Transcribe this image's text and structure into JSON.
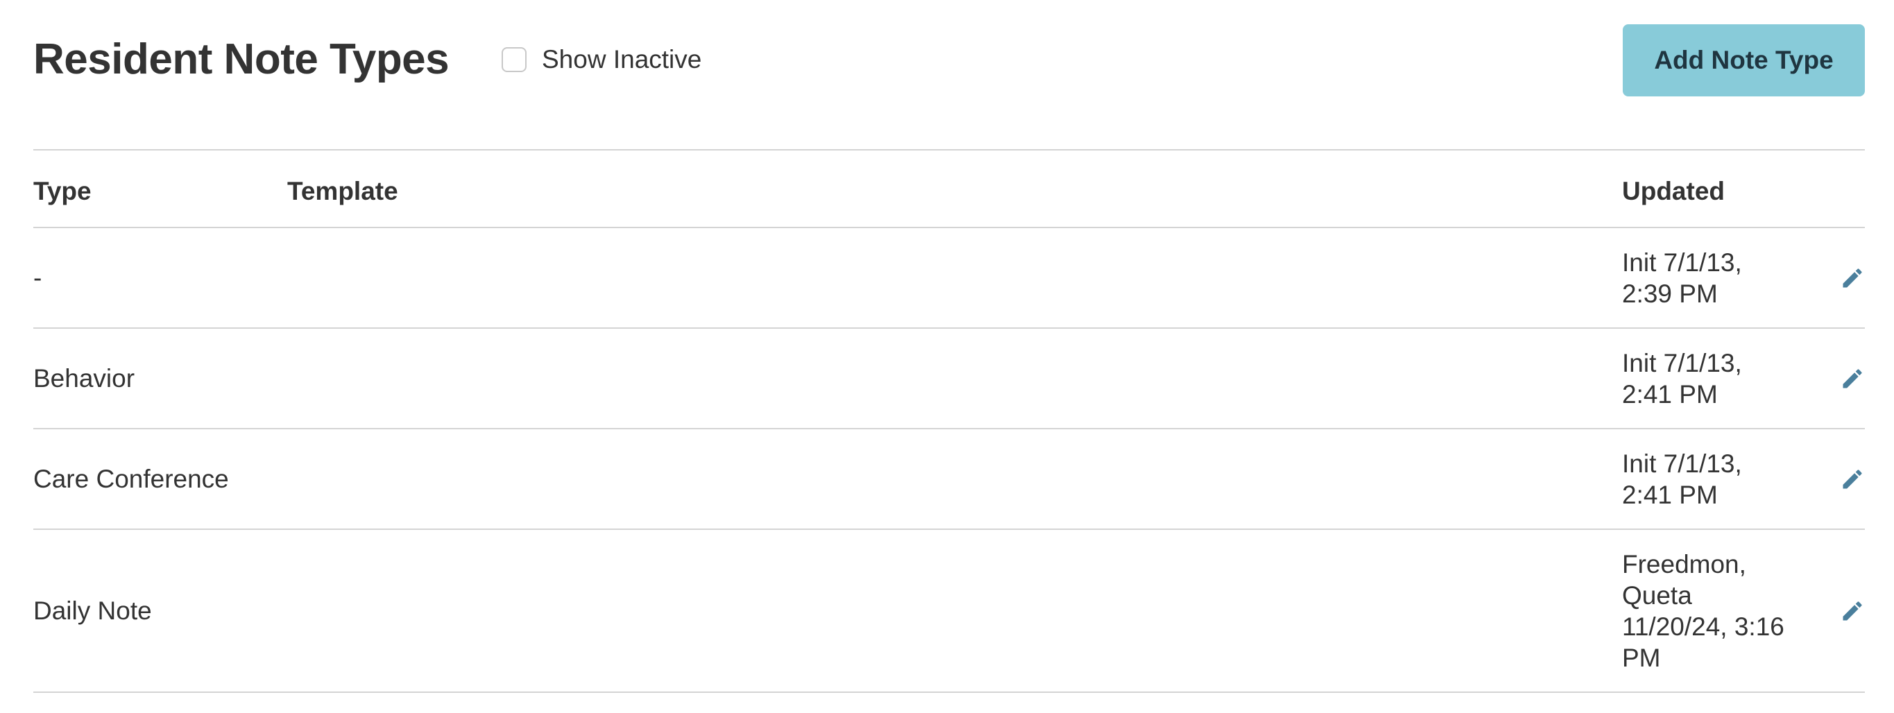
{
  "header": {
    "title": "Resident Note Types",
    "show_inactive_label": "Show Inactive",
    "show_inactive_checked": false,
    "add_button_label": "Add Note Type",
    "add_button_color": "#88cbd9"
  },
  "table": {
    "columns": {
      "type": "Type",
      "template": "Template",
      "updated": "Updated"
    },
    "rows": [
      {
        "type": "-",
        "template": "",
        "updated_line1": "Init 7/1/13,",
        "updated_line2": "2:39 PM",
        "updated_line3": "",
        "updated_line4": ""
      },
      {
        "type": "Behavior",
        "template": "",
        "updated_line1": "Init 7/1/13,",
        "updated_line2": "2:41 PM",
        "updated_line3": "",
        "updated_line4": ""
      },
      {
        "type": "Care Conference",
        "template": "",
        "updated_line1": "Init 7/1/13,",
        "updated_line2": "2:41 PM",
        "updated_line3": "",
        "updated_line4": ""
      },
      {
        "type": "Daily Note",
        "template": "",
        "updated_line1": "Freedmon,",
        "updated_line2": "Queta",
        "updated_line3": "11/20/24, 3:16",
        "updated_line4": "PM"
      }
    ],
    "edit_icon": "pencil-icon",
    "edit_icon_color": "#4a7f9c"
  }
}
